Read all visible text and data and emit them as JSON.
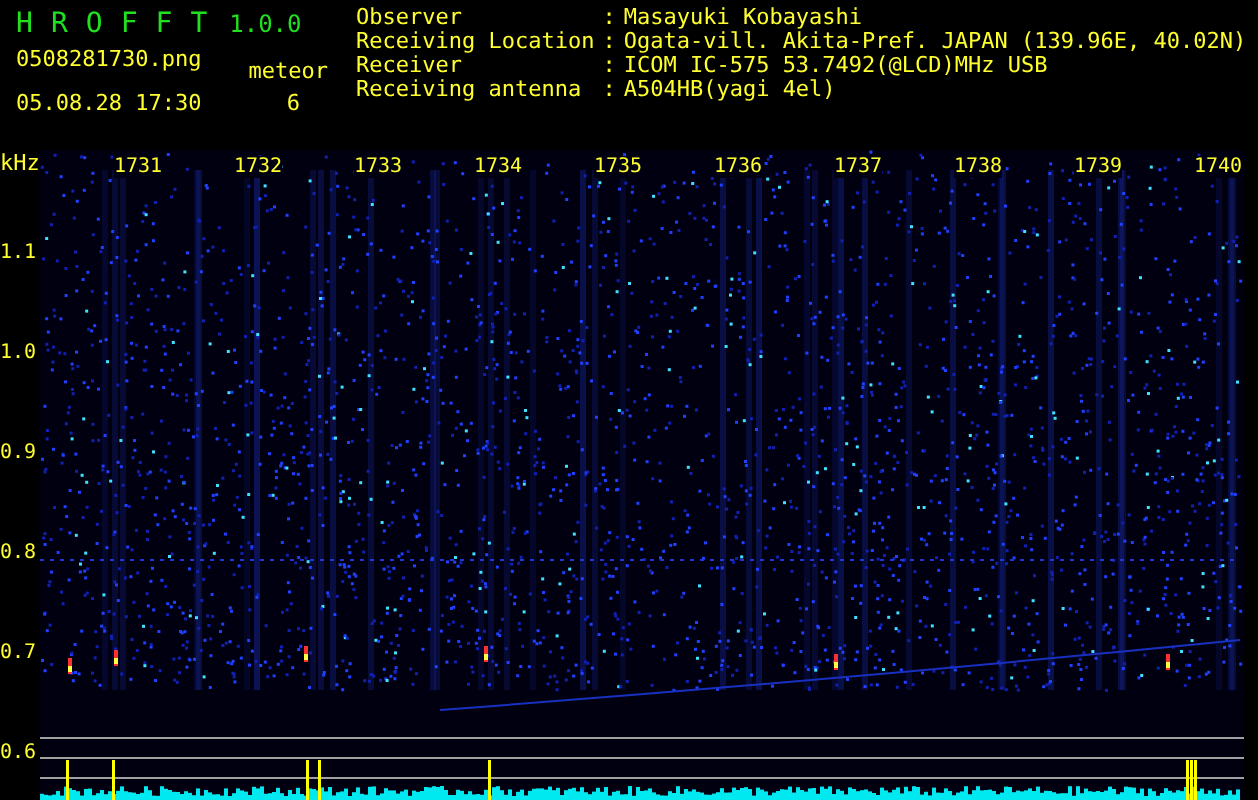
{
  "app": {
    "letters": [
      "H",
      "R",
      "O",
      "F",
      "F",
      "T"
    ],
    "version": "1.0.0"
  },
  "file": {
    "name": "0508281730.png",
    "datetime": "05.08.28 17:30"
  },
  "meteor": {
    "label": "meteor",
    "count": "6"
  },
  "info": [
    {
      "label": "Observer",
      "sep": ":",
      "value": "Masayuki Kobayashi"
    },
    {
      "label": "Receiving Location",
      "sep": ":",
      "value": "Ogata-vill. Akita-Pref. JAPAN (139.96E, 40.02N)"
    },
    {
      "label": "Receiver",
      "sep": ":",
      "value": "ICOM IC-575 53.7492(@LCD)MHz USB"
    },
    {
      "label": "Receiving antenna",
      "sep": ":",
      "value": "A504HB(yagi 4el)"
    }
  ],
  "spectrogram": {
    "unit": "kHz",
    "time_labels": [
      "1731",
      "1732",
      "1733",
      "1734",
      "1735",
      "1736",
      "1737",
      "1738",
      "1739",
      "1740"
    ],
    "freq_labels": [
      "1.1",
      "1.0",
      "0.9",
      "0.8",
      "0.7",
      "0.6"
    ]
  }
}
